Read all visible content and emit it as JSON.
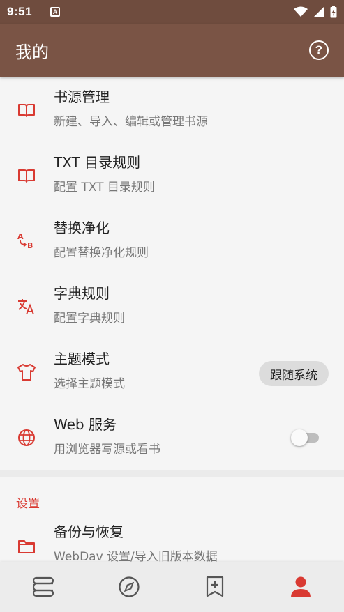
{
  "status_bar": {
    "time": "9:51",
    "notif_glyph": "A"
  },
  "app_bar": {
    "title": "我的",
    "help_glyph": "?"
  },
  "menu_items": [
    {
      "title": "书源管理",
      "subtitle": "新建、导入、编辑或管理书源",
      "icon": "book-open-icon"
    },
    {
      "title": "TXT 目录规则",
      "subtitle": "配置 TXT 目录规则",
      "icon": "book-open-icon"
    },
    {
      "title": "替换净化",
      "subtitle": "配置替换净化规则",
      "icon": "replace-ab-icon"
    },
    {
      "title": "字典规则",
      "subtitle": "配置字典规则",
      "icon": "translate-icon"
    },
    {
      "title": "主题模式",
      "subtitle": "选择主题模式",
      "icon": "shirt-icon",
      "chip": "跟随系统"
    },
    {
      "title": "Web 服务",
      "subtitle": "用浏览器写源或看书",
      "icon": "globe-icon",
      "toggle_on": false
    }
  ],
  "settings": {
    "header": "设置",
    "items": [
      {
        "title": "备份与恢复",
        "subtitle": "WebDav 设置/导入旧版本数据",
        "icon": "folder-icon"
      }
    ]
  },
  "bottom_nav": [
    {
      "icon": "bookshelf-icon",
      "active": false
    },
    {
      "icon": "compass-icon",
      "active": false
    },
    {
      "icon": "bookmark-add-icon",
      "active": false
    },
    {
      "icon": "person-icon",
      "active": true
    }
  ],
  "colors": {
    "primary": "#7a5445",
    "status": "#6f4c3e",
    "accent": "#d93a32",
    "nav_inactive": "#555555"
  }
}
